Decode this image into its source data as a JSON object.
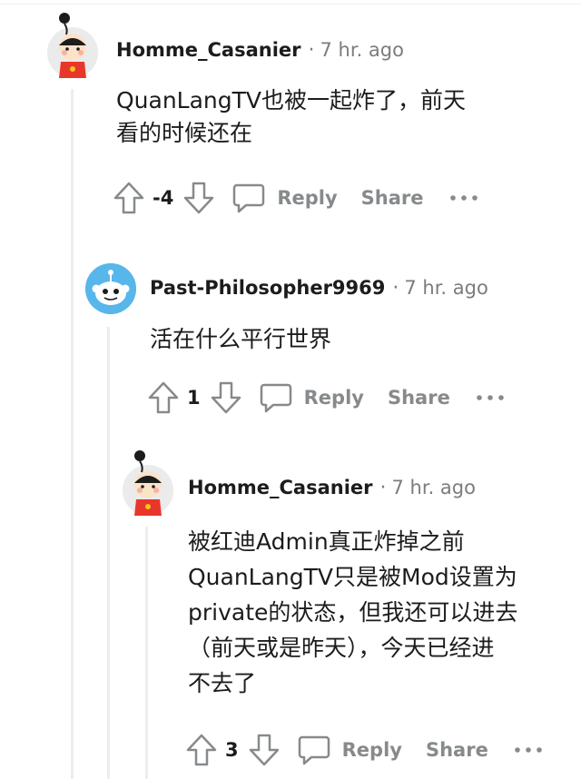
{
  "comments": [
    {
      "username": "Homme_Casanier",
      "time": "7 hr. ago",
      "body": [
        "QuanLangTV也被一起炸了，前天",
        "看的时候还在"
      ],
      "score": "-4",
      "reply_label": "Reply",
      "share_label": "Share",
      "avatar_icon": "cartoon-boy-avatar"
    },
    {
      "username": "Past-Philosopher9969",
      "time": "7 hr. ago",
      "body": [
        "活在什么平行世界"
      ],
      "score": "1",
      "reply_label": "Reply",
      "share_label": "Share",
      "avatar_icon": "snoo-avatar"
    },
    {
      "username": "Homme_Casanier",
      "time": "7 hr. ago",
      "body": [
        "被红迪Admin真正炸掉之前",
        "QuanLangTV只是被Mod设置为",
        "private的状态，但我还可以进去",
        "（前天或是昨天），今天已经进",
        "不去了"
      ],
      "score": "3",
      "reply_label": "Reply",
      "share_label": "Share",
      "avatar_icon": "cartoon-boy-avatar"
    }
  ],
  "colors": {
    "meta_gray": "#7c7c7c",
    "action_gray": "#878a8c",
    "thread_line": "#ededed",
    "snoo_blue": "#57b6ea"
  }
}
